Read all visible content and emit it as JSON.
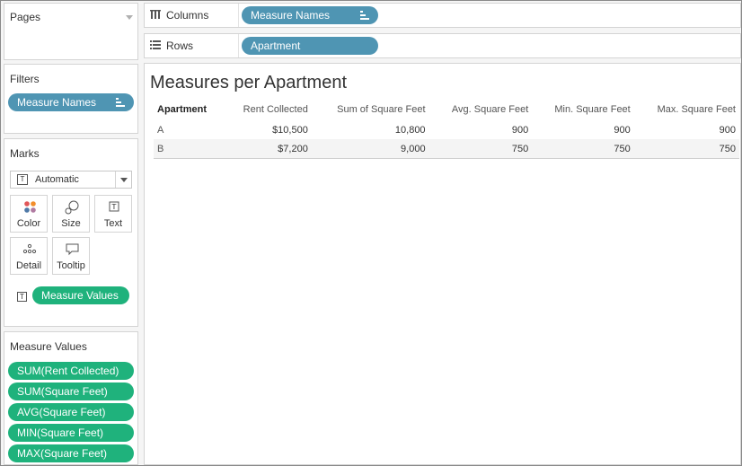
{
  "pages_card": {
    "title": "Pages"
  },
  "columns_shelf": {
    "label": "Columns",
    "pill": "Measure Names"
  },
  "rows_shelf": {
    "label": "Rows",
    "pill": "Apartment"
  },
  "filters_card": {
    "title": "Filters",
    "pill": "Measure Names"
  },
  "marks_card": {
    "title": "Marks",
    "mark_type": "Automatic",
    "buttons": {
      "color": "Color",
      "size": "Size",
      "text": "Text",
      "detail": "Detail",
      "tooltip": "Tooltip"
    },
    "text_pill": "Measure Values"
  },
  "measure_values_card": {
    "title": "Measure Values",
    "pills": [
      "SUM(Rent Collected)",
      "SUM(Square Feet)",
      "AVG(Square Feet)",
      "MIN(Square Feet)",
      "MAX(Square Feet)"
    ]
  },
  "view": {
    "title": "Measures per Apartment",
    "headers": [
      "Apartment",
      "Rent Collected",
      "Sum of Square Feet",
      "Avg. Square Feet",
      "Min. Square Feet",
      "Max. Square Feet"
    ],
    "rows": [
      [
        "A",
        "$10,500",
        "10,800",
        "900",
        "900",
        "900"
      ],
      [
        "B",
        "$7,200",
        "9,000",
        "750",
        "750",
        "750"
      ]
    ]
  },
  "colors": {
    "dimension_pill": "#4f95b3",
    "measure_pill": "#1fb27c"
  }
}
